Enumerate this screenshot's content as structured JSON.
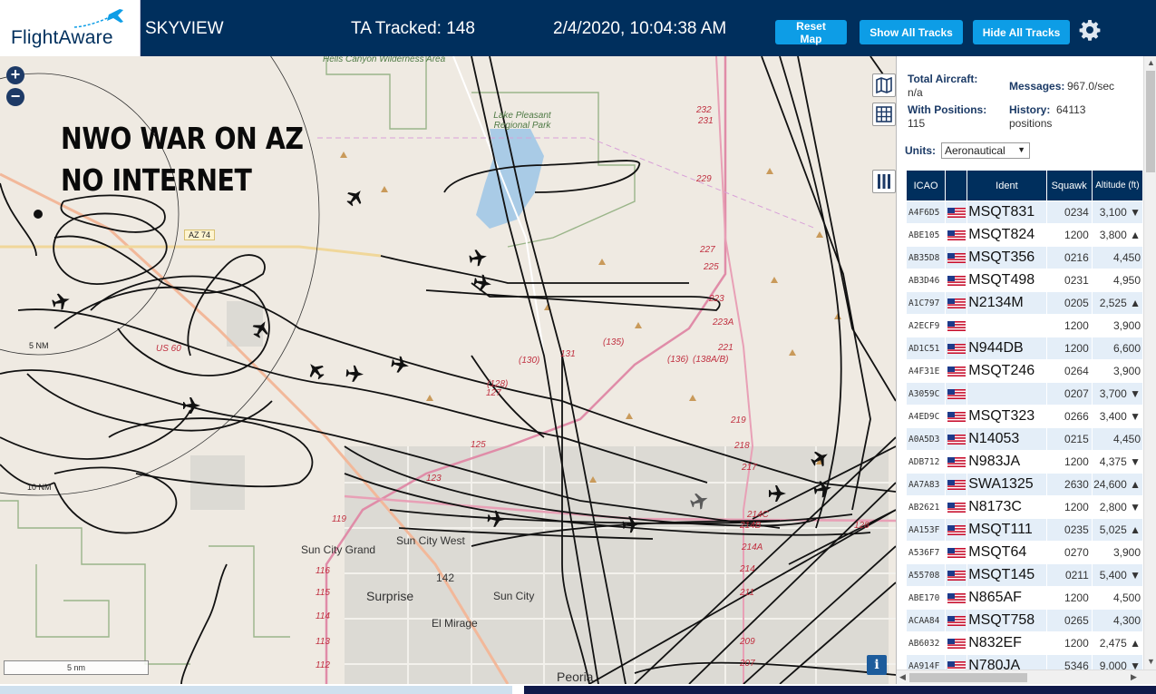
{
  "brand": {
    "logo_text": "FlightAware",
    "app_name": "SKYVIEW"
  },
  "header": {
    "tracked": "TA Tracked: 148",
    "datetime": "2/4/2020, 10:04:38 AM",
    "buttons": {
      "reset": "Reset Map",
      "show": "Show All Tracks",
      "hide": "Hide All Tracks"
    }
  },
  "map": {
    "overlay_line1": "NWO WAR ON AZ",
    "overlay_line2": "NO INTERNET",
    "zoom_in": "+",
    "zoom_out": "−",
    "scale_label": "5 nm",
    "range_rings": [
      "5 NM",
      "10 NM"
    ],
    "info": "i",
    "places": {
      "hells_canyon": "Hells Canyon Wilderness Area",
      "lake_pleasant": "Lake Pleasant Regional Park",
      "az74": "AZ 74",
      "us60": "US 60",
      "sun_city_grand": "Sun City Grand",
      "sun_city_west": "Sun City West",
      "surprise": "Surprise",
      "sun_city": "Sun City",
      "el_mirage": "El Mirage",
      "peoria": "Peoria"
    },
    "road_labels": [
      "232",
      "231",
      "229",
      "227",
      "225",
      "223",
      "223A",
      "221",
      "219",
      "218",
      "217",
      "214C",
      "214B",
      "214A",
      "214",
      "211",
      "209",
      "207",
      "142",
      "119",
      "116",
      "115",
      "114",
      "113",
      "112",
      "127",
      "125",
      "123",
      "(128)",
      "(130)",
      "131",
      "(135)",
      "(136)",
      "(138A/B)",
      "128"
    ]
  },
  "panel": {
    "total_aircraft_label": "Total Aircraft:",
    "total_aircraft_value": "n/a",
    "with_positions_label": "With Positions:",
    "with_positions_value": "115",
    "messages_label": "Messages:",
    "messages_value": "967.0/sec",
    "history_label": "History:",
    "history_value": "64113 positions",
    "units_label": "Units:",
    "units_value": "Aeronautical",
    "columns": [
      "ICAO",
      "Ident",
      "Squawk",
      "Altitude (ft)"
    ],
    "rows": [
      {
        "icao": "A4F6D5",
        "ident": "MSQT831",
        "squawk": "0234",
        "alt": "3,100 ▼"
      },
      {
        "icao": "ABE105",
        "ident": "MSQT824",
        "squawk": "1200",
        "alt": "3,800 ▲"
      },
      {
        "icao": "AB35D8",
        "ident": "MSQT356",
        "squawk": "0216",
        "alt": "4,450"
      },
      {
        "icao": "AB3D46",
        "ident": "MSQT498",
        "squawk": "0231",
        "alt": "4,950"
      },
      {
        "icao": "A1C797",
        "ident": "N2134M",
        "squawk": "0205",
        "alt": "2,525 ▲"
      },
      {
        "icao": "A2ECF9",
        "ident": "",
        "squawk": "1200",
        "alt": "3,900"
      },
      {
        "icao": "AD1C51",
        "ident": "N944DB",
        "squawk": "1200",
        "alt": "6,600"
      },
      {
        "icao": "A4F31E",
        "ident": "MSQT246",
        "squawk": "0264",
        "alt": "3,900"
      },
      {
        "icao": "A3059C",
        "ident": "",
        "squawk": "0207",
        "alt": "3,700 ▼"
      },
      {
        "icao": "A4ED9C",
        "ident": "MSQT323",
        "squawk": "0266",
        "alt": "3,400 ▼"
      },
      {
        "icao": "A0A5D3",
        "ident": "N14053",
        "squawk": "0215",
        "alt": "4,450"
      },
      {
        "icao": "ADB712",
        "ident": "N983JA",
        "squawk": "1200",
        "alt": "4,375 ▼"
      },
      {
        "icao": "AA7A83",
        "ident": "SWA1325",
        "squawk": "2630",
        "alt": "24,600 ▲"
      },
      {
        "icao": "AB2621",
        "ident": "N8173C",
        "squawk": "1200",
        "alt": "2,800 ▼"
      },
      {
        "icao": "AA153F",
        "ident": "MSQT111",
        "squawk": "0235",
        "alt": "5,025 ▲"
      },
      {
        "icao": "A536F7",
        "ident": "MSQT64",
        "squawk": "0270",
        "alt": "3,900"
      },
      {
        "icao": "A55708",
        "ident": "MSQT145",
        "squawk": "0211",
        "alt": "5,400 ▼"
      },
      {
        "icao": "ABE170",
        "ident": "N865AF",
        "squawk": "1200",
        "alt": "4,500"
      },
      {
        "icao": "ACAA84",
        "ident": "MSQT758",
        "squawk": "0265",
        "alt": "4,300"
      },
      {
        "icao": "AB6032",
        "ident": "N832EF",
        "squawk": "1200",
        "alt": "2,475 ▲"
      },
      {
        "icao": "AA914F",
        "ident": "N780JA",
        "squawk": "5346",
        "alt": "9,000 ▼"
      }
    ]
  },
  "colors": {
    "header_bg": "#002f5d",
    "button": "#0d9de6",
    "row_alt": "#e4eef8",
    "map_bg": "#efeae2"
  },
  "icons": [
    "map-toggle-icon",
    "grid-icon",
    "columns-icon",
    "gear-icon",
    "us-flag-icon",
    "airplane-icon"
  ]
}
